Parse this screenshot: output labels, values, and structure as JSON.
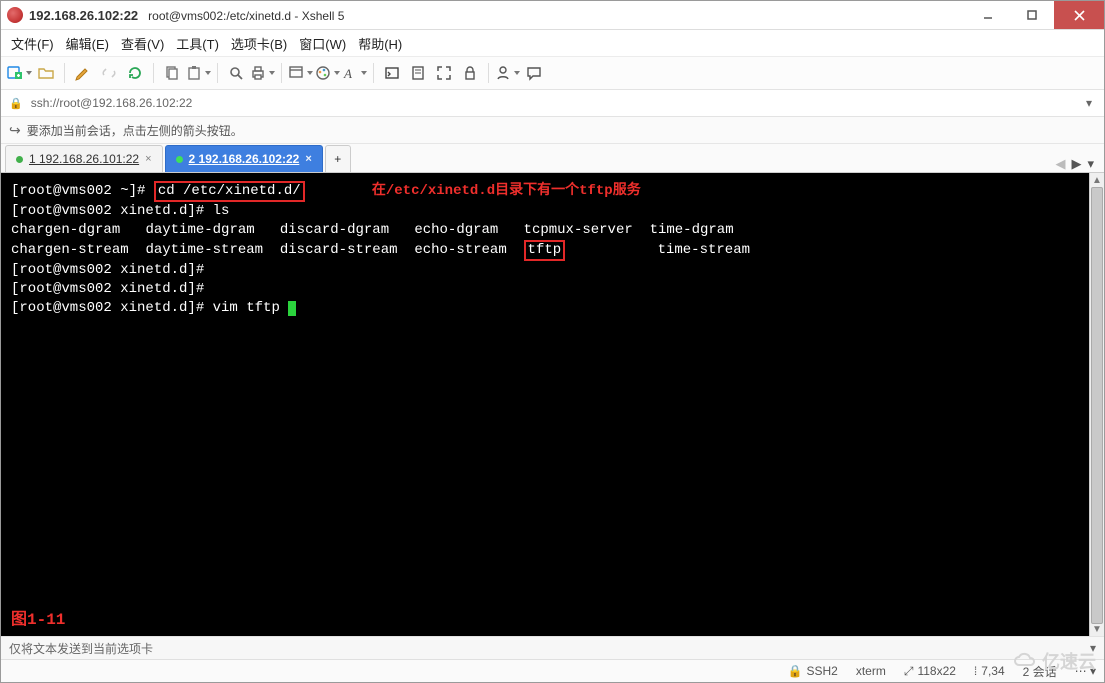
{
  "title": {
    "address": "192.168.26.102:22",
    "path": "root@vms002:/etc/xinetd.d - Xshell 5"
  },
  "menu": {
    "file": "文件(F)",
    "edit": "编辑(E)",
    "view": "查看(V)",
    "tools": "工具(T)",
    "tabs": "选项卡(B)",
    "window": "窗口(W)",
    "help": "帮助(H)"
  },
  "address_bar": {
    "url": "ssh://root@192.168.26.102:22"
  },
  "tip_bar": {
    "text": "要添加当前会话，点击左侧的箭头按钮。"
  },
  "tabs": {
    "t1_label": "1 192.168.26.101:22",
    "t2_label": "2 192.168.26.102:22",
    "add_label": "+"
  },
  "terminal": {
    "line1_prompt": "[root@vms002 ~]# ",
    "line1_cmd": "cd /etc/xinetd.d/",
    "line1_ann": "在/etc/xinetd.d目录下有一个tftp服务",
    "line2": "[root@vms002 xinetd.d]# ls",
    "ls_row1_c1": "chargen-dgram",
    "ls_row1_c2": "daytime-dgram",
    "ls_row1_c3": "discard-dgram",
    "ls_row1_c4": "echo-dgram",
    "ls_row1_c5": "tcpmux-server",
    "ls_row1_c6": "time-dgram",
    "ls_row2_c1": "chargen-stream",
    "ls_row2_c2": "daytime-stream",
    "ls_row2_c3": "discard-stream",
    "ls_row2_c4": "echo-stream",
    "ls_row2_c5": "tftp",
    "ls_row2_c6": "time-stream",
    "line5": "[root@vms002 xinetd.d]#",
    "line6": "[root@vms002 xinetd.d]#",
    "line7": "[root@vms002 xinetd.d]# vim tftp ",
    "fig_label": "图1-11"
  },
  "send_bar": {
    "text": "仅将文本发送到当前选项卡"
  },
  "status": {
    "ssh": "SSH2",
    "term": "xterm",
    "size": "118x22",
    "pos": "7,34",
    "sessions": "2 会话"
  },
  "watermark": {
    "text": "亿速云"
  }
}
